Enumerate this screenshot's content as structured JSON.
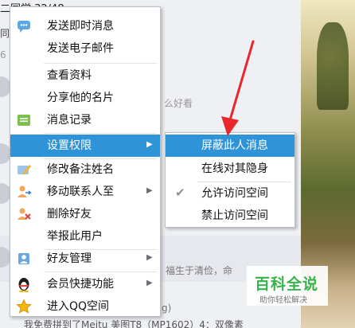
{
  "background": {
    "group_header": "二同学 32/48",
    "line_fragment_1": "同",
    "line_fragment_2": "6",
    "line_fragment_3": "么好看",
    "line_fragment_4": "福生于清俭，命",
    "line_fragment_5": "g)",
    "line_fragment_6": "我免费拼到了Meitu 美图T8（MP1602）4：双像素"
  },
  "context_menu": {
    "items": [
      {
        "label": "发送即时消息",
        "icon": "chat-bubble-icon"
      },
      {
        "label": "发送电子邮件",
        "icon": ""
      },
      {
        "label": "查看资料",
        "icon": ""
      },
      {
        "label": "分享他的名片",
        "icon": ""
      },
      {
        "label": "消息记录",
        "icon": "message-log-icon"
      },
      {
        "label": "设置权限",
        "icon": "",
        "has_submenu": true,
        "active": true
      },
      {
        "label": "修改备注姓名",
        "icon": "edit-name-icon"
      },
      {
        "label": "移动联系人至",
        "icon": "move-contact-icon",
        "has_submenu": true
      },
      {
        "label": "删除好友",
        "icon": "delete-friend-icon"
      },
      {
        "label": "举报此用户",
        "icon": ""
      },
      {
        "label": "好友管理",
        "icon": "friend-manage-icon",
        "has_submenu": true
      },
      {
        "label": "会员快捷功能",
        "icon": "qq-penguin-icon",
        "has_submenu": true
      },
      {
        "label": "进入QQ空间",
        "icon": "qzone-star-icon"
      }
    ]
  },
  "submenu": {
    "items": [
      {
        "label": "屏蔽此人消息",
        "active": true
      },
      {
        "label": "在线对其隐身"
      },
      {
        "label": "允许访问空间",
        "checked": true
      },
      {
        "label": "禁止访问空间"
      }
    ]
  },
  "watermark": {
    "title": "百科全说",
    "subtitle": "助你轻松解决"
  },
  "colors": {
    "highlight": "#2f93d8",
    "annotation_arrow": "#e8262b",
    "watermark_green": "#36b34a"
  }
}
